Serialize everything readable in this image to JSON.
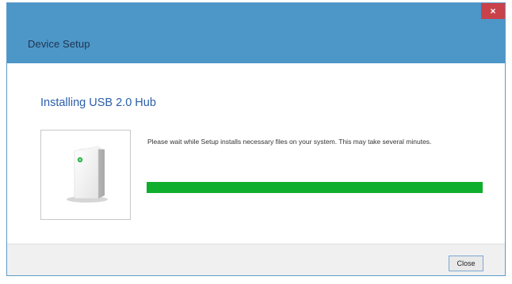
{
  "window": {
    "title": "Device Setup",
    "close_glyph": "×"
  },
  "main": {
    "heading": "Installing USB 2.0 Hub",
    "message": "Please wait while Setup installs necessary files on your system. This may take several minutes.",
    "device_icon": "hub-device-icon",
    "progress_percent": 100
  },
  "footer": {
    "close_label": "Close"
  },
  "colors": {
    "titlebar": "#4d96c8",
    "close_button_red": "#c9424a",
    "heading": "#2a5ea8",
    "progress": "#0fae2c"
  }
}
